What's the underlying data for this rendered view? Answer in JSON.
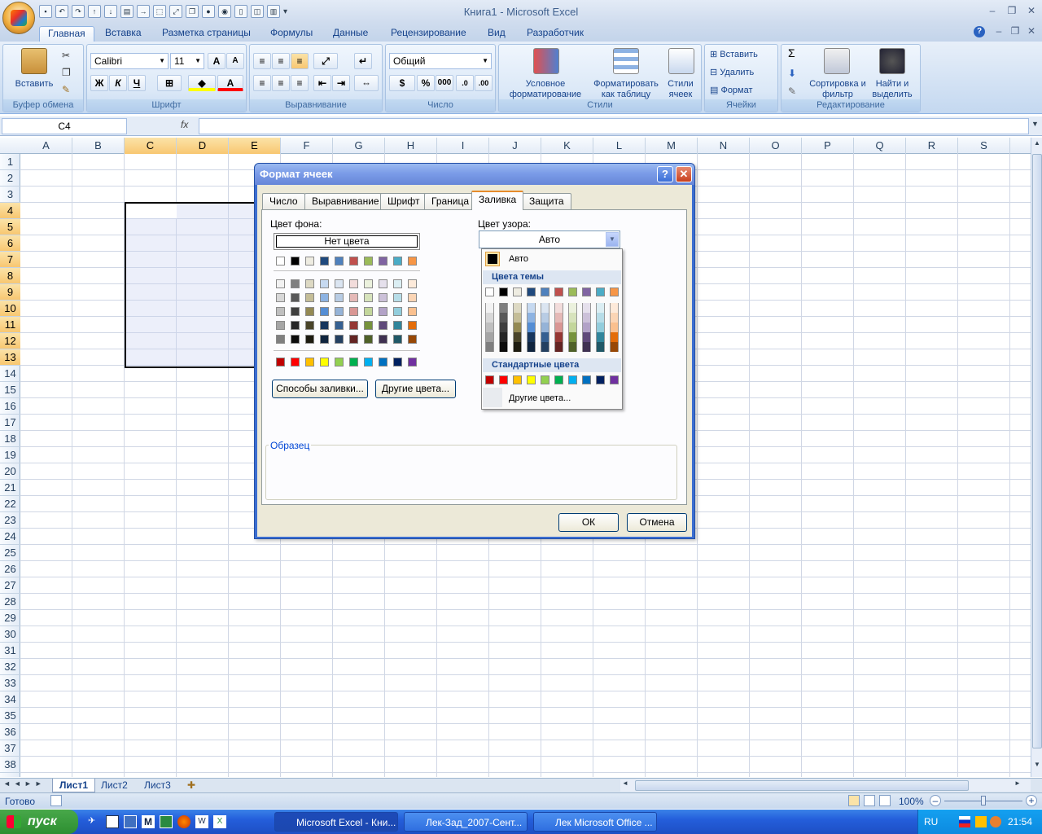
{
  "app": {
    "title": "Книга1 - Microsoft Excel"
  },
  "tabs": [
    "Главная",
    "Вставка",
    "Разметка страницы",
    "Формулы",
    "Данные",
    "Рецензирование",
    "Вид",
    "Разработчик"
  ],
  "ribbon": {
    "clipboard": {
      "paste": "Вставить",
      "label": "Буфер обмена"
    },
    "font": {
      "name": "Calibri",
      "size": "11",
      "bold": "Ж",
      "italic": "К",
      "underline": "Ч",
      "grow": "A",
      "shrink": "A",
      "color": "A",
      "label": "Шрифт"
    },
    "alignment": {
      "label": "Выравнивание"
    },
    "number": {
      "format": "Общий",
      "percent": "%",
      "thousands": "000",
      "label": "Число"
    },
    "styles": {
      "conditional": "Условное форматирование",
      "as_table": "Форматировать как таблицу",
      "cell_styles": "Стили ячеек",
      "label": "Стили"
    },
    "cells": {
      "insert": "Вставить",
      "delete": "Удалить",
      "format": "Формат",
      "label": "Ячейки"
    },
    "editing": {
      "sigma": "Σ",
      "sort": "Сортировка и фильтр",
      "find": "Найти и выделить",
      "label": "Редактирование"
    }
  },
  "formula_bar": {
    "name_box": "C4",
    "fx": "fx",
    "value": ""
  },
  "columns": [
    "A",
    "B",
    "C",
    "D",
    "E",
    "F",
    "G",
    "H",
    "I",
    "J",
    "K",
    "L",
    "M",
    "N",
    "O",
    "P",
    "Q",
    "R",
    "S"
  ],
  "selected_columns": [
    "C",
    "D",
    "E"
  ],
  "rows": [
    "1",
    "2",
    "3",
    "4",
    "5",
    "6",
    "7",
    "8",
    "9",
    "10",
    "11",
    "12",
    "13",
    "14",
    "15",
    "16",
    "17",
    "18",
    "19",
    "20",
    "21",
    "22",
    "23",
    "24",
    "25",
    "26",
    "27",
    "28",
    "29",
    "30",
    "31",
    "32",
    "33",
    "34",
    "35",
    "36",
    "37",
    "38"
  ],
  "selected_rows": [
    "4",
    "5",
    "6",
    "7",
    "8",
    "9",
    "10",
    "11",
    "12",
    "13"
  ],
  "sheets": [
    "Лист1",
    "Лист2",
    "Лист3"
  ],
  "status": {
    "ready": "Готово",
    "zoom": "100%"
  },
  "dialog": {
    "title": "Формат ячеек",
    "tabs": [
      "Число",
      "Выравнивание",
      "Шрифт",
      "Граница",
      "Заливка",
      "Защита"
    ],
    "active_tab": "Заливка",
    "bg_color_label": "Цвет фона:",
    "no_color": "Нет цвета",
    "pattern_color_label": "Цвет узора:",
    "pattern_color_value": "Авто",
    "fill_effects": "Способы заливки...",
    "more_colors": "Другие цвета...",
    "sample_label": "Образец",
    "ok": "ОК",
    "cancel": "Отмена",
    "dropdown": {
      "auto": "Авто",
      "theme_colors": "Цвета темы",
      "standard_colors": "Стандартные цвета",
      "more_colors": "Другие цвета..."
    }
  },
  "theme_top": [
    "#ffffff",
    "#000000",
    "#eeece1",
    "#1f497d",
    "#4f81bd",
    "#c0504d",
    "#9bbb59",
    "#8064a2",
    "#4bacc6",
    "#f79646"
  ],
  "theme_shades": [
    [
      "#f2f2f2",
      "#7f7f7f",
      "#ddd9c3",
      "#c6d9f0",
      "#dbe5f1",
      "#f2dcdb",
      "#ebf1dd",
      "#e5e0ec",
      "#dbeef3",
      "#fdeada"
    ],
    [
      "#d8d8d8",
      "#595959",
      "#c4bd97",
      "#8db3e2",
      "#b8cce4",
      "#e5b9b7",
      "#d7e3bc",
      "#ccc1d9",
      "#b7dde8",
      "#fbd5b5"
    ],
    [
      "#bfbfbf",
      "#3f3f3f",
      "#938953",
      "#548dd4",
      "#95b3d7",
      "#d99694",
      "#c3d69b",
      "#b2a2c7",
      "#92cddc",
      "#fac08f"
    ],
    [
      "#a5a5a5",
      "#262626",
      "#494429",
      "#17365d",
      "#366092",
      "#953734",
      "#76923c",
      "#5f497a",
      "#31859b",
      "#e36c09"
    ],
    [
      "#7f7f7f",
      "#0c0c0c",
      "#1d1b10",
      "#0f243e",
      "#244061",
      "#632423",
      "#4f6128",
      "#3f3151",
      "#205867",
      "#974806"
    ]
  ],
  "standard_colors": [
    "#c00000",
    "#ff0000",
    "#ffc000",
    "#ffff00",
    "#92d050",
    "#00b050",
    "#00b0f0",
    "#0070c0",
    "#002060",
    "#7030a0"
  ],
  "taskbar": {
    "start": "пуск",
    "tasks": [
      "Microsoft Excel - Кни...",
      "Лек-Зад_2007-Сент...",
      "Лек Microsoft Office ..."
    ],
    "lang": "RU",
    "time": "21:54"
  }
}
